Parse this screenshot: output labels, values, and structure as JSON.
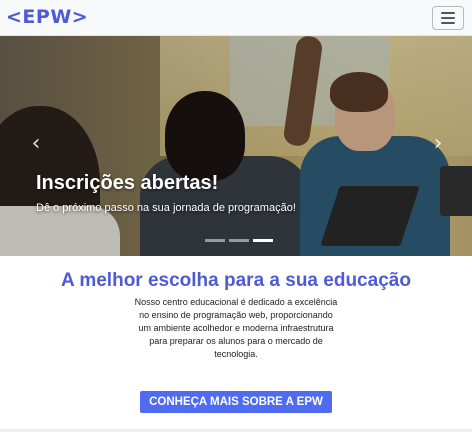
{
  "navbar": {
    "brand": "<EPW>",
    "toggler_icon": "hamburger-menu-icon"
  },
  "carousel": {
    "title": "Inscrições abertas!",
    "subtitle": "Dê o próximo passo na sua jornada de programação!",
    "prev_icon": "‹",
    "next_icon": "›",
    "indicator_count": 3,
    "active_indicator": 3
  },
  "main": {
    "headline": "A melhor escolha para a sua educação",
    "description": "Nosso centro educacional é dedicado a excelência no ensino de programação web, proporcionando um ambiente acolhedor e moderna infraestrutura para preparar os alunos para o mercado de tecnologia.",
    "cta_label": "CONHEÇA MAIS SOBRE A EPW"
  },
  "colors": {
    "accent": "#4f5bd5",
    "button": "#4f6bf2",
    "navbar_bg": "#f8f9fa"
  }
}
